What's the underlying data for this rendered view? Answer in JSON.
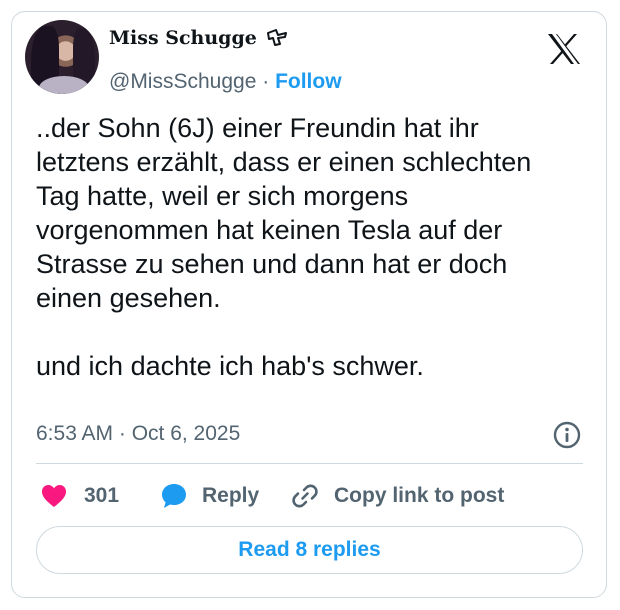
{
  "author": {
    "display_name": "Miss Schugge",
    "handle": "@MissSchugge",
    "follow_label": "Follow",
    "separator": " · "
  },
  "tweet": {
    "text": "..der Sohn (6J) einer Freundin hat ihr\nletztens erzählt, dass er einen schlechten\nTag hatte, weil er sich morgens\nvorgenommen hat keinen Tesla auf der\nStrasse zu sehen und dann hat er doch\neinen gesehen.\n\nund ich dachte ich hab's schwer.",
    "timestamp": "6:53 AM · Oct 6, 2025"
  },
  "actions": {
    "like_count": "301",
    "reply_label": "Reply",
    "copy_link_label": "Copy link to post"
  },
  "footer": {
    "read_replies_label": "Read 8 replies"
  },
  "icons": {
    "logo": "x-logo-icon",
    "info": "info-icon",
    "heart": "heart-icon",
    "reply": "reply-bubble-icon",
    "link": "link-icon",
    "name_glyph": "fist-emoji-icon"
  },
  "colors": {
    "accent": "#1d9bf0",
    "heart": "#f91880",
    "text": "#0f1419",
    "secondary": "#536471",
    "border": "#cfd9de"
  }
}
